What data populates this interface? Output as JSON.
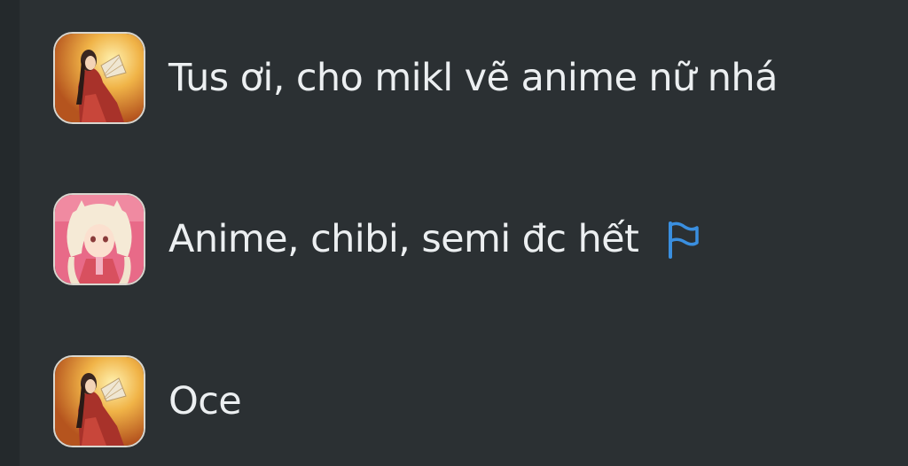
{
  "messages": [
    {
      "avatar": "avatar-woman-fan-icon",
      "text": "Tus ơi, cho mikl vẽ anime nữ nhá",
      "flagged": false
    },
    {
      "avatar": "avatar-anime-girl-icon",
      "text": "Anime, chibi, semi đc hết",
      "flagged": true
    },
    {
      "avatar": "avatar-woman-fan-icon",
      "text": "Oce",
      "flagged": false
    }
  ],
  "colors": {
    "background": "#2b3033",
    "text": "#eceff1",
    "flag": "#3a8fe0",
    "avatar_border": "#d9d6cf"
  }
}
